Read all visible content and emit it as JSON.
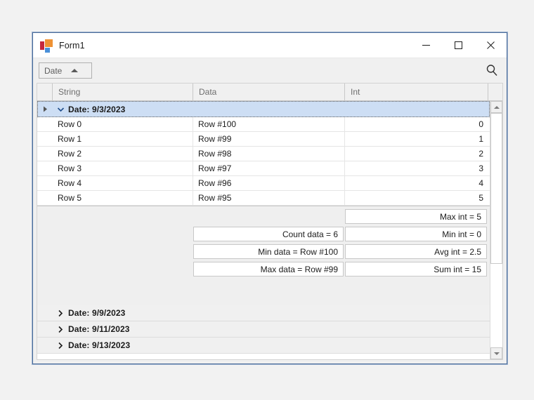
{
  "window": {
    "title": "Form1",
    "app_icon": "visual-studio-logo-icon",
    "controls": {
      "minimize": "—",
      "maximize": "□",
      "close": "✕"
    }
  },
  "toolbar": {
    "sort_label": "Date",
    "sort_direction": "ascending",
    "sort_caret": "caret-up-icon",
    "search_icon": "search-icon"
  },
  "grid": {
    "columns": [
      {
        "key": "indicator",
        "label": ""
      },
      {
        "key": "string",
        "label": "String"
      },
      {
        "key": "data",
        "label": "Data"
      },
      {
        "key": "int",
        "label": "Int"
      }
    ],
    "expanded_group": {
      "label": "Date: 9/3/2023",
      "expander_icon": "chevron-down-icon",
      "row_indicator_icon": "caret-right-icon",
      "selected": true,
      "rows": [
        {
          "string": "Row 0",
          "data": "Row #100",
          "int": "0"
        },
        {
          "string": "Row 1",
          "data": "Row #99",
          "int": "1"
        },
        {
          "string": "Row 2",
          "data": "Row #98",
          "int": "2"
        },
        {
          "string": "Row 3",
          "data": "Row #97",
          "int": "3"
        },
        {
          "string": "Row 4",
          "data": "Row #96",
          "int": "4"
        },
        {
          "string": "Row 5",
          "data": "Row #95",
          "int": "5"
        }
      ],
      "summary": {
        "string_column": [],
        "data_column": [
          "Count data = 6",
          "Min data = Row #100",
          "Max data = Row #99"
        ],
        "int_column": [
          "Max int = 5",
          "Min int = 0",
          "Avg int = 2.5",
          "Sum int = 15"
        ]
      }
    },
    "collapsed_groups": [
      {
        "label": "Date: 9/9/2023",
        "expander_icon": "chevron-right-icon"
      },
      {
        "label": "Date: 9/11/2023",
        "expander_icon": "chevron-right-icon"
      },
      {
        "label": "Date: 9/13/2023",
        "expander_icon": "chevron-right-icon"
      }
    ]
  },
  "scrollbar": {
    "up_icon": "arrow-up-icon",
    "down_icon": "arrow-down-icon"
  },
  "colors": {
    "window_border": "#4a6b9a",
    "selection": "#cddef4",
    "chrome": "#f0f0f0",
    "accent_red": "#c5283d",
    "accent_orange": "#ef9234",
    "accent_blue": "#4a90d9"
  }
}
